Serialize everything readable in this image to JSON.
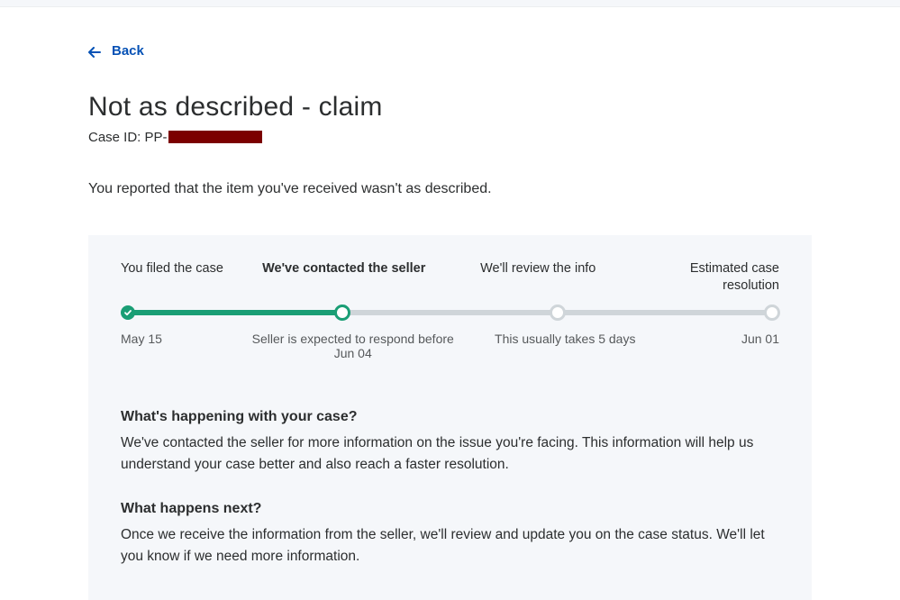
{
  "nav": {
    "back_label": "Back"
  },
  "header": {
    "title": "Not as described - claim",
    "case_label": "Case ID: PP-",
    "case_rest_redacted": true
  },
  "report_line": "You reported that the item you've received wasn't as described.",
  "stepper": {
    "steps": [
      {
        "label": "You filed the case",
        "sub": "May 15",
        "state": "done"
      },
      {
        "label": "We've contacted the seller",
        "sub": "Seller is expected to respond before Jun 04",
        "state": "current"
      },
      {
        "label": "We'll review the info",
        "sub": "This usually takes 5 days",
        "state": "upcoming"
      },
      {
        "label": "Estimated case resolution",
        "sub": "Jun 01",
        "state": "upcoming"
      }
    ],
    "progress_fraction": 0.333
  },
  "sections": [
    {
      "heading": "What's happening with your case?",
      "body": "We've contacted the seller for more information on the issue you're facing. This information will help us understand your case better and also reach a faster resolution."
    },
    {
      "heading": "What happens next?",
      "body": "Once we receive the information from the seller, we'll review and update you on the case status. We'll let you know if we need more information."
    }
  ],
  "colors": {
    "accent_link": "#0551b5",
    "progress_green": "#1a9e75",
    "panel_bg": "#f5f7fa",
    "redaction": "#7b0000"
  }
}
